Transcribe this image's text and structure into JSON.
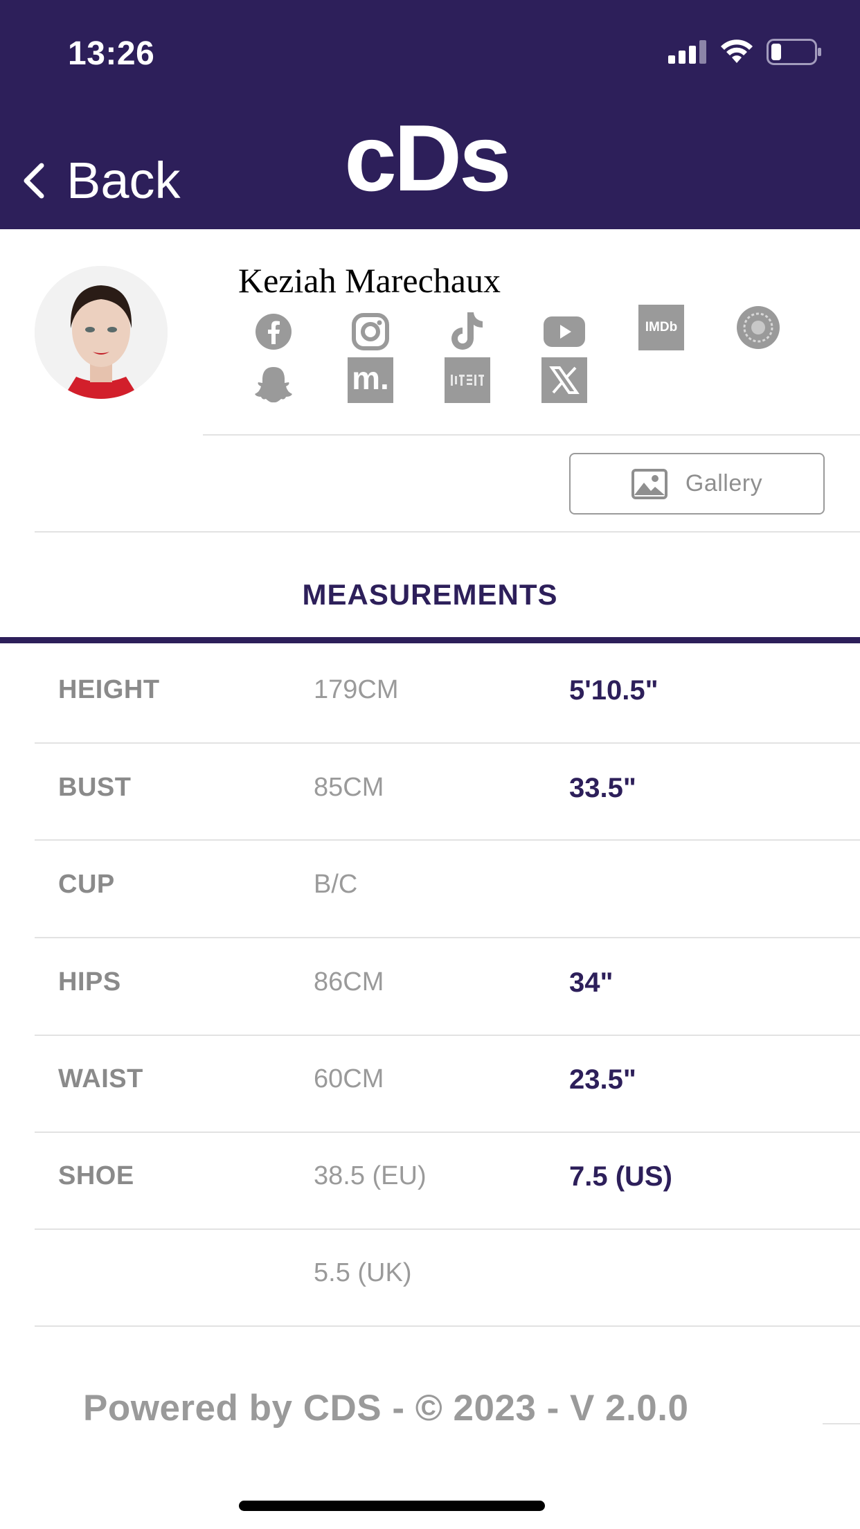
{
  "status_bar": {
    "time": "13:26"
  },
  "header": {
    "back_label": "Back",
    "logo": "cDs"
  },
  "profile": {
    "name": "Keziah Marechaux",
    "social_icons": [
      "facebook-icon",
      "instagram-icon",
      "tiktok-icon",
      "youtube-icon",
      "imdb-icon",
      "models-com-icon",
      "snapchat-icon",
      "mubi-icon",
      "xiaohongshu-icon",
      "x-twitter-icon"
    ],
    "imdb_text": "IMDb",
    "mubi_text": "m."
  },
  "gallery": {
    "label": "Gallery"
  },
  "measurements": {
    "title": "MEASUREMENTS",
    "rows": [
      {
        "label": "HEIGHT",
        "metric": "179CM",
        "imperial": "5'10.5\""
      },
      {
        "label": "BUST",
        "metric": "85CM",
        "imperial": "33.5\""
      },
      {
        "label": "CUP",
        "metric": "B/C",
        "imperial": ""
      },
      {
        "label": "HIPS",
        "metric": "86CM",
        "imperial": "34\""
      },
      {
        "label": "WAIST",
        "metric": "60CM",
        "imperial": "23.5\""
      },
      {
        "label": "SHOE",
        "metric": "38.5 (EU)",
        "imperial": "7.5 (US)"
      },
      {
        "label": "",
        "metric": "5.5 (UK)",
        "imperial": ""
      }
    ]
  },
  "footer": {
    "text": "Powered by CDS - © 2023 - V 2.0.0"
  },
  "colors": {
    "brand": "#2d1f5a",
    "label_gray": "#8a8a8a",
    "divider": "#e2e2e2"
  }
}
